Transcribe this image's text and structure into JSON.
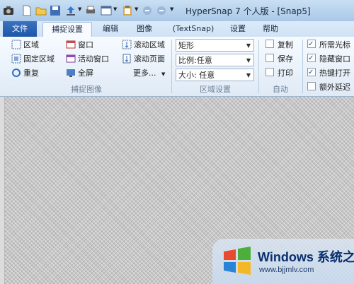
{
  "title": "HyperSnap 7 个人版 - [Snap5]",
  "tabs": {
    "file": "文件",
    "items": [
      "捕捉设置",
      "编辑",
      "图像",
      "(TextSnap)",
      "设置",
      "帮助"
    ]
  },
  "ribbon": {
    "capture": {
      "col1": [
        "区域",
        "固定区域",
        "重复"
      ],
      "col2": [
        "窗口",
        "活动窗口",
        "全屏"
      ],
      "col3": [
        "滚动区域",
        "滚动页面",
        "更多..."
      ],
      "group_label": "捕捉图像"
    },
    "region": {
      "combos": [
        "矩形",
        "比例:任意",
        "大小: 任意"
      ],
      "group_label": "区域设置"
    },
    "auto": {
      "items": [
        "复制",
        "保存",
        "打印"
      ],
      "checked": [
        false,
        false,
        false
      ],
      "group_label": "自动"
    },
    "options": {
      "items": [
        "所需光标",
        "隐藏窗口",
        "热键打开",
        "额外延迟"
      ],
      "checked": [
        true,
        true,
        true,
        false
      ]
    }
  },
  "watermark": {
    "brand": "Windows 系统之家",
    "url": "www.bjjmlv.com"
  },
  "colors": {
    "accent": "#2a62b2",
    "ribbon_bg": "#eaf2fb",
    "canvas": "#c6c6c6"
  }
}
